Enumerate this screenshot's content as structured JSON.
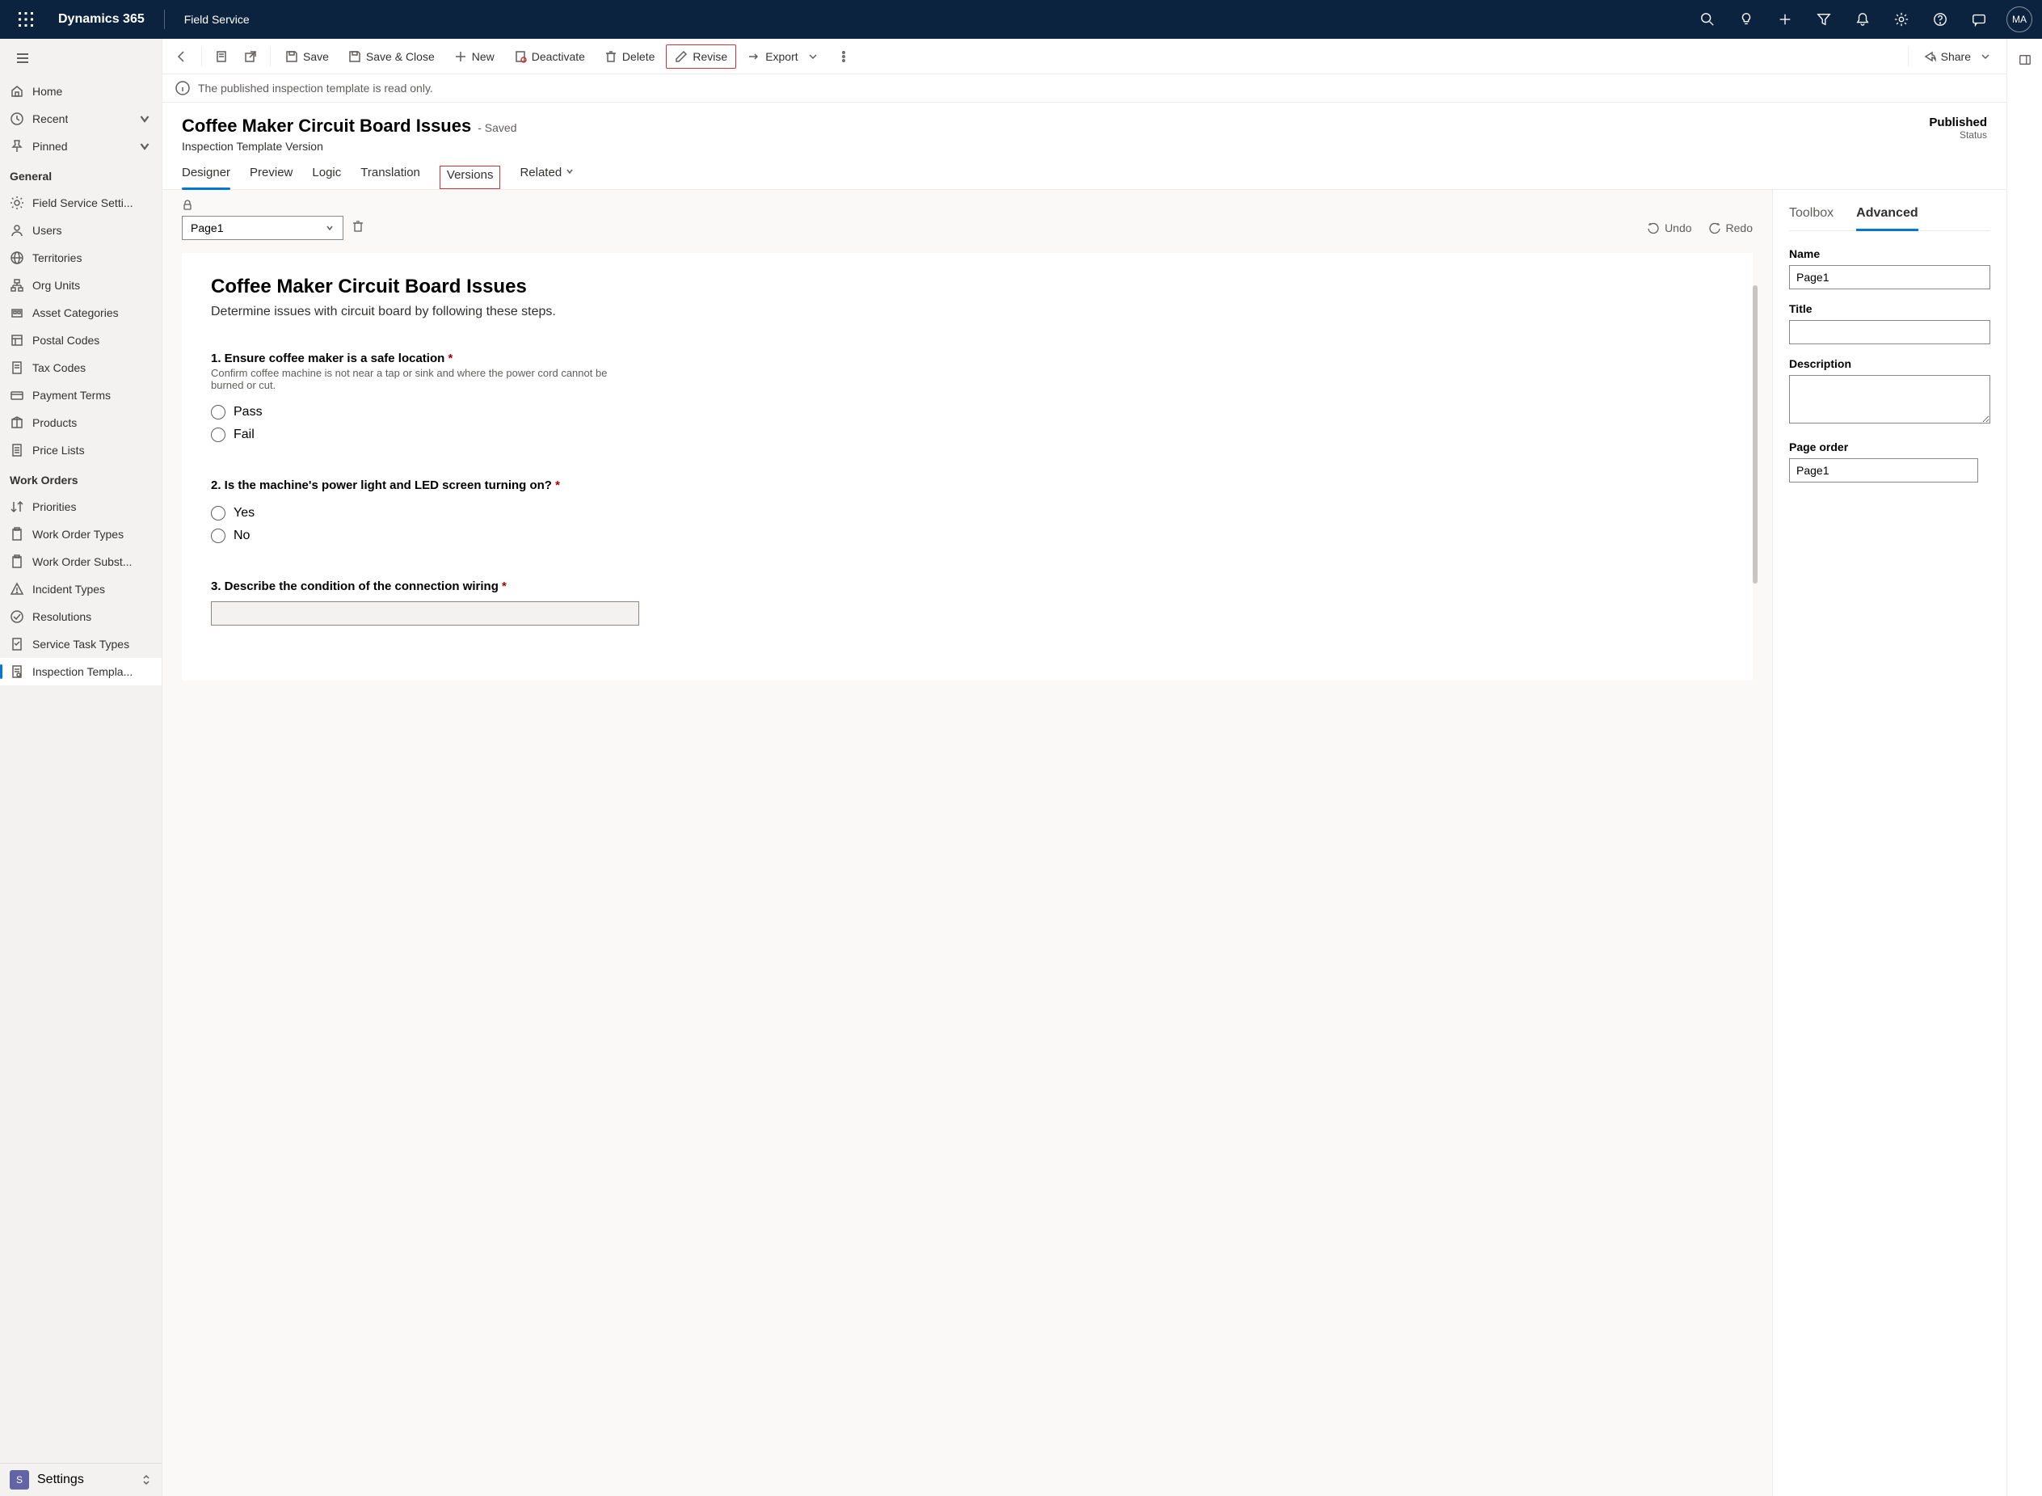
{
  "topbar": {
    "product": "Dynamics 365",
    "module": "Field Service",
    "avatar": "MA"
  },
  "sidebar": {
    "top": [
      {
        "label": "Home",
        "icon": "home"
      },
      {
        "label": "Recent",
        "icon": "clock",
        "expand": true
      },
      {
        "label": "Pinned",
        "icon": "pin",
        "expand": true
      }
    ],
    "sections": [
      {
        "title": "General",
        "items": [
          {
            "label": "Field Service Setti...",
            "icon": "gear"
          },
          {
            "label": "Users",
            "icon": "user"
          },
          {
            "label": "Territories",
            "icon": "globe"
          },
          {
            "label": "Org Units",
            "icon": "org"
          },
          {
            "label": "Asset Categories",
            "icon": "asset"
          },
          {
            "label": "Postal Codes",
            "icon": "postal"
          },
          {
            "label": "Tax Codes",
            "icon": "doc"
          },
          {
            "label": "Payment Terms",
            "icon": "payment"
          },
          {
            "label": "Products",
            "icon": "box"
          },
          {
            "label": "Price Lists",
            "icon": "list"
          }
        ]
      },
      {
        "title": "Work Orders",
        "items": [
          {
            "label": "Priorities",
            "icon": "sort"
          },
          {
            "label": "Work Order Types",
            "icon": "clipboard"
          },
          {
            "label": "Work Order Subst...",
            "icon": "clipboard"
          },
          {
            "label": "Incident Types",
            "icon": "warning"
          },
          {
            "label": "Resolutions",
            "icon": "check"
          },
          {
            "label": "Service Task Types",
            "icon": "task"
          },
          {
            "label": "Inspection Templa...",
            "icon": "inspect",
            "active": true
          }
        ]
      }
    ],
    "footer": {
      "badge": "S",
      "label": "Settings"
    }
  },
  "commands": {
    "save": "Save",
    "saveClose": "Save & Close",
    "new": "New",
    "deactivate": "Deactivate",
    "delete": "Delete",
    "revise": "Revise",
    "export": "Export",
    "share": "Share"
  },
  "notification": "The published inspection template is read only.",
  "record": {
    "title": "Coffee Maker Circuit Board Issues",
    "saved": "- Saved",
    "subtitle": "Inspection Template Version",
    "statusValue": "Published",
    "statusLabel": "Status"
  },
  "tabs": [
    "Designer",
    "Preview",
    "Logic",
    "Translation",
    "Versions",
    "Related"
  ],
  "designer": {
    "pageSelect": "Page1",
    "undo": "Undo",
    "redo": "Redo",
    "canvas": {
      "title": "Coffee Maker Circuit Board Issues",
      "desc": "Determine issues with circuit board by following these steps."
    },
    "questions": [
      {
        "num": "1.",
        "label": "Ensure coffee maker is a safe location",
        "required": true,
        "help": "Confirm coffee machine is not near a tap or sink and where the power cord cannot be burned or cut.",
        "type": "radio",
        "options": [
          "Pass",
          "Fail"
        ]
      },
      {
        "num": "2.",
        "label": "Is the machine's power light and LED screen turning on?",
        "required": true,
        "type": "radio",
        "options": [
          "Yes",
          "No"
        ]
      },
      {
        "num": "3.",
        "label": "Describe the condition of the connection wiring",
        "required": true,
        "type": "text"
      }
    ]
  },
  "props": {
    "tabs": [
      "Toolbox",
      "Advanced"
    ],
    "fields": {
      "name": {
        "label": "Name",
        "value": "Page1"
      },
      "title": {
        "label": "Title",
        "value": ""
      },
      "description": {
        "label": "Description",
        "value": ""
      },
      "pageOrder": {
        "label": "Page order",
        "value": "Page1"
      }
    }
  }
}
